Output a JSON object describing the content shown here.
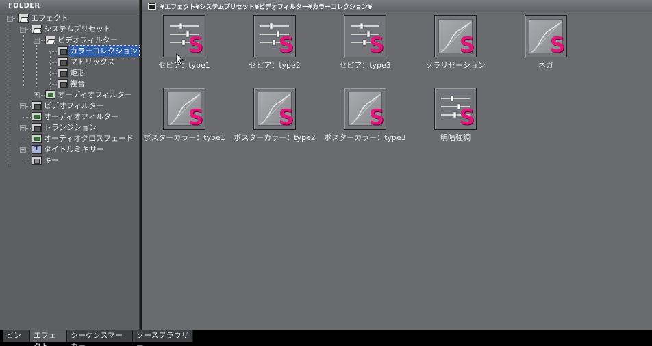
{
  "folder_panel": {
    "header": "FOLDER",
    "tree": [
      {
        "label": "エフェクト",
        "icon": "folder-open-icon",
        "level": 0,
        "expander": "−"
      },
      {
        "label": "システムプリセット",
        "icon": "folder-open-icon",
        "level": 1,
        "expander": "−"
      },
      {
        "label": "ビデオフィルター",
        "icon": "folder-open-icon",
        "level": 2,
        "expander": "−"
      },
      {
        "label": "カラーコレクション",
        "icon": "film-icon",
        "level": 3,
        "expander": "",
        "selected": true
      },
      {
        "label": "マトリックス",
        "icon": "film-icon",
        "level": 3,
        "expander": ""
      },
      {
        "label": "矩形",
        "icon": "film-icon",
        "level": 3,
        "expander": ""
      },
      {
        "label": "複合",
        "icon": "film-icon",
        "level": 3,
        "expander": ""
      },
      {
        "label": "オーディオフィルター",
        "icon": "audio-icon",
        "level": 2,
        "expander": "+"
      },
      {
        "label": "ビデオフィルター",
        "icon": "film-icon",
        "level": 1,
        "expander": "+"
      },
      {
        "label": "オーディオフィルター",
        "icon": "audio-icon",
        "level": 1,
        "expander": ""
      },
      {
        "label": "トランジション",
        "icon": "film-icon",
        "level": 1,
        "expander": "+"
      },
      {
        "label": "オーディオクロスフェード",
        "icon": "audio-icon",
        "level": 1,
        "expander": ""
      },
      {
        "label": "タイトルミキサー",
        "icon": "title-icon",
        "level": 1,
        "expander": "+"
      },
      {
        "label": "キー",
        "icon": "key-icon",
        "level": 1,
        "expander": ""
      }
    ]
  },
  "content_panel": {
    "path": "¥エフェクト¥システムプリセット¥ビデオフィルター¥カラーコレクション¥",
    "items": [
      {
        "label": "セピア：type1",
        "thumb": "sliders"
      },
      {
        "label": "セピア：type2",
        "thumb": "sliders"
      },
      {
        "label": "セピア：type3",
        "thumb": "sliders"
      },
      {
        "label": "ソラリゼーション",
        "thumb": "graph"
      },
      {
        "label": "ネガ",
        "thumb": "graph"
      },
      {
        "label": "ポスターカラー：type1",
        "thumb": "graph"
      },
      {
        "label": "ポスターカラー：type2",
        "thumb": "graph"
      },
      {
        "label": "ポスターカラー：type3",
        "thumb": "graph"
      },
      {
        "label": "明暗強調",
        "thumb": "sliders"
      }
    ],
    "badge_letter": "S",
    "badge_color": "#e0177b"
  },
  "bottom_tabs": [
    {
      "label": "ビン",
      "active": false
    },
    {
      "label": "エフェクト",
      "active": true
    },
    {
      "label": "シーケンスマーカー",
      "active": false
    },
    {
      "label": "ソースブラウザー",
      "active": false
    }
  ],
  "colors": {
    "panel_bg": "#6a6b6f",
    "selection": "#2f5ea9"
  }
}
